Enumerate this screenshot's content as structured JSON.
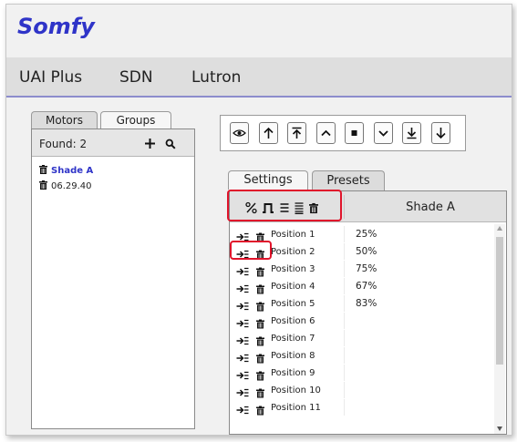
{
  "app": {
    "brand": "Somfy"
  },
  "nav": {
    "items": [
      {
        "label": "UAI Plus"
      },
      {
        "label": "SDN"
      },
      {
        "label": "Lutron"
      }
    ]
  },
  "left_tabs": {
    "motors": "Motors",
    "groups": "Groups",
    "active": "Motors"
  },
  "motor_list": {
    "found_label": "Found: 2",
    "add_icon": "plus-icon",
    "search_icon": "search-icon",
    "items": [
      {
        "label": "Shade A",
        "selected": true
      },
      {
        "label": "06.29.40",
        "selected": false
      }
    ]
  },
  "toolbar": {
    "buttons": [
      "eye-icon",
      "arrow-up-icon",
      "arrow-to-top-icon",
      "chevron-up-icon",
      "stop-icon",
      "chevron-down-icon",
      "arrow-to-bottom-icon",
      "arrow-down-icon"
    ]
  },
  "right_tabs": {
    "settings": "Settings",
    "presets": "Presets",
    "active": "Presets"
  },
  "presets_grid": {
    "header_icons": [
      "percent-icon",
      "pulse-icon",
      "list-icon",
      "align-icon",
      "trash-icon"
    ],
    "header_title": "Shade A",
    "rows": [
      {
        "name": "Position 1",
        "value": "25%"
      },
      {
        "name": "Position 2",
        "value": "50%"
      },
      {
        "name": "Position 3",
        "value": "75%"
      },
      {
        "name": "Position 4",
        "value": "67%"
      },
      {
        "name": "Position 5",
        "value": "83%"
      },
      {
        "name": "Position 6",
        "value": ""
      },
      {
        "name": "Position 7",
        "value": ""
      },
      {
        "name": "Position 8",
        "value": ""
      },
      {
        "name": "Position 9",
        "value": ""
      },
      {
        "name": "Position 10",
        "value": ""
      },
      {
        "name": "Position 11",
        "value": ""
      }
    ]
  },
  "colors": {
    "brand": "#2f34c8",
    "highlight": "#e0142b",
    "nav_border": "#8c8ccc"
  }
}
